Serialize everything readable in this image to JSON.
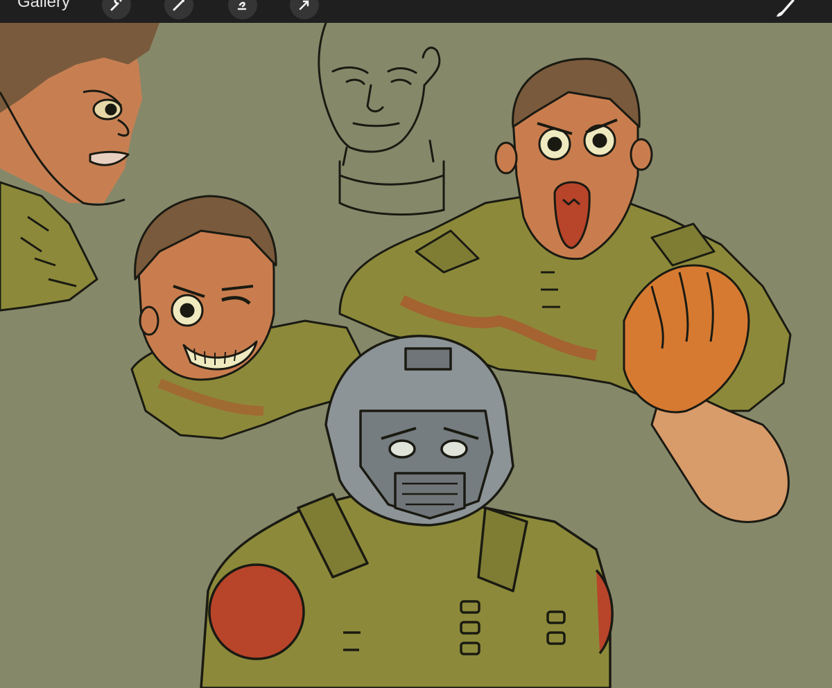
{
  "toolbar": {
    "gallery_label": "Gallery",
    "tools": [
      {
        "name": "adjustments-icon"
      },
      {
        "name": "selection-icon"
      },
      {
        "name": "transform-icon"
      },
      {
        "name": "actions-icon"
      }
    ],
    "active_tool": "brush-icon"
  },
  "canvas": {
    "background_color": "#86886a",
    "artwork": "character-sketches"
  },
  "colors": {
    "toolbar_bg": "#1f1f1f",
    "button_bg": "#353535",
    "armor_green": "#8c8a3a",
    "skin": "#d58e5c",
    "hair": "#7a5a3c",
    "helmet_gray": "#8d9497",
    "red_accent": "#b8442a"
  }
}
